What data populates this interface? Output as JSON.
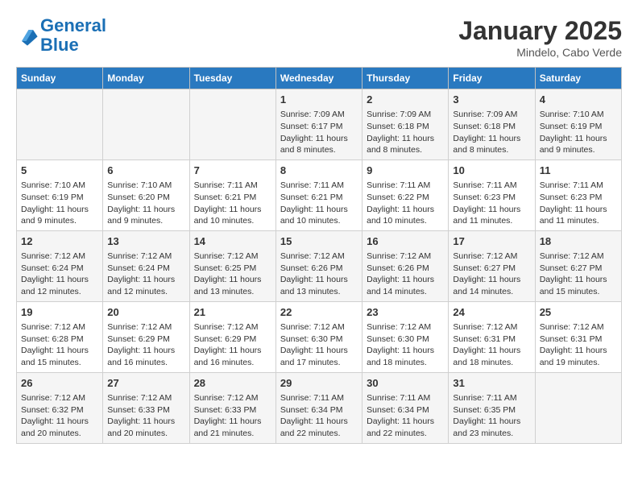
{
  "header": {
    "logo_line1": "General",
    "logo_line2": "Blue",
    "title": "January 2025",
    "subtitle": "Mindelo, Cabo Verde"
  },
  "days_of_week": [
    "Sunday",
    "Monday",
    "Tuesday",
    "Wednesday",
    "Thursday",
    "Friday",
    "Saturday"
  ],
  "weeks": [
    [
      {
        "num": "",
        "info": ""
      },
      {
        "num": "",
        "info": ""
      },
      {
        "num": "",
        "info": ""
      },
      {
        "num": "1",
        "info": "Sunrise: 7:09 AM\nSunset: 6:17 PM\nDaylight: 11 hours and 8 minutes."
      },
      {
        "num": "2",
        "info": "Sunrise: 7:09 AM\nSunset: 6:18 PM\nDaylight: 11 hours and 8 minutes."
      },
      {
        "num": "3",
        "info": "Sunrise: 7:09 AM\nSunset: 6:18 PM\nDaylight: 11 hours and 8 minutes."
      },
      {
        "num": "4",
        "info": "Sunrise: 7:10 AM\nSunset: 6:19 PM\nDaylight: 11 hours and 9 minutes."
      }
    ],
    [
      {
        "num": "5",
        "info": "Sunrise: 7:10 AM\nSunset: 6:19 PM\nDaylight: 11 hours and 9 minutes."
      },
      {
        "num": "6",
        "info": "Sunrise: 7:10 AM\nSunset: 6:20 PM\nDaylight: 11 hours and 9 minutes."
      },
      {
        "num": "7",
        "info": "Sunrise: 7:11 AM\nSunset: 6:21 PM\nDaylight: 11 hours and 10 minutes."
      },
      {
        "num": "8",
        "info": "Sunrise: 7:11 AM\nSunset: 6:21 PM\nDaylight: 11 hours and 10 minutes."
      },
      {
        "num": "9",
        "info": "Sunrise: 7:11 AM\nSunset: 6:22 PM\nDaylight: 11 hours and 10 minutes."
      },
      {
        "num": "10",
        "info": "Sunrise: 7:11 AM\nSunset: 6:23 PM\nDaylight: 11 hours and 11 minutes."
      },
      {
        "num": "11",
        "info": "Sunrise: 7:11 AM\nSunset: 6:23 PM\nDaylight: 11 hours and 11 minutes."
      }
    ],
    [
      {
        "num": "12",
        "info": "Sunrise: 7:12 AM\nSunset: 6:24 PM\nDaylight: 11 hours and 12 minutes."
      },
      {
        "num": "13",
        "info": "Sunrise: 7:12 AM\nSunset: 6:24 PM\nDaylight: 11 hours and 12 minutes."
      },
      {
        "num": "14",
        "info": "Sunrise: 7:12 AM\nSunset: 6:25 PM\nDaylight: 11 hours and 13 minutes."
      },
      {
        "num": "15",
        "info": "Sunrise: 7:12 AM\nSunset: 6:26 PM\nDaylight: 11 hours and 13 minutes."
      },
      {
        "num": "16",
        "info": "Sunrise: 7:12 AM\nSunset: 6:26 PM\nDaylight: 11 hours and 14 minutes."
      },
      {
        "num": "17",
        "info": "Sunrise: 7:12 AM\nSunset: 6:27 PM\nDaylight: 11 hours and 14 minutes."
      },
      {
        "num": "18",
        "info": "Sunrise: 7:12 AM\nSunset: 6:27 PM\nDaylight: 11 hours and 15 minutes."
      }
    ],
    [
      {
        "num": "19",
        "info": "Sunrise: 7:12 AM\nSunset: 6:28 PM\nDaylight: 11 hours and 15 minutes."
      },
      {
        "num": "20",
        "info": "Sunrise: 7:12 AM\nSunset: 6:29 PM\nDaylight: 11 hours and 16 minutes."
      },
      {
        "num": "21",
        "info": "Sunrise: 7:12 AM\nSunset: 6:29 PM\nDaylight: 11 hours and 16 minutes."
      },
      {
        "num": "22",
        "info": "Sunrise: 7:12 AM\nSunset: 6:30 PM\nDaylight: 11 hours and 17 minutes."
      },
      {
        "num": "23",
        "info": "Sunrise: 7:12 AM\nSunset: 6:30 PM\nDaylight: 11 hours and 18 minutes."
      },
      {
        "num": "24",
        "info": "Sunrise: 7:12 AM\nSunset: 6:31 PM\nDaylight: 11 hours and 18 minutes."
      },
      {
        "num": "25",
        "info": "Sunrise: 7:12 AM\nSunset: 6:31 PM\nDaylight: 11 hours and 19 minutes."
      }
    ],
    [
      {
        "num": "26",
        "info": "Sunrise: 7:12 AM\nSunset: 6:32 PM\nDaylight: 11 hours and 20 minutes."
      },
      {
        "num": "27",
        "info": "Sunrise: 7:12 AM\nSunset: 6:33 PM\nDaylight: 11 hours and 20 minutes."
      },
      {
        "num": "28",
        "info": "Sunrise: 7:12 AM\nSunset: 6:33 PM\nDaylight: 11 hours and 21 minutes."
      },
      {
        "num": "29",
        "info": "Sunrise: 7:11 AM\nSunset: 6:34 PM\nDaylight: 11 hours and 22 minutes."
      },
      {
        "num": "30",
        "info": "Sunrise: 7:11 AM\nSunset: 6:34 PM\nDaylight: 11 hours and 22 minutes."
      },
      {
        "num": "31",
        "info": "Sunrise: 7:11 AM\nSunset: 6:35 PM\nDaylight: 11 hours and 23 minutes."
      },
      {
        "num": "",
        "info": ""
      }
    ]
  ]
}
